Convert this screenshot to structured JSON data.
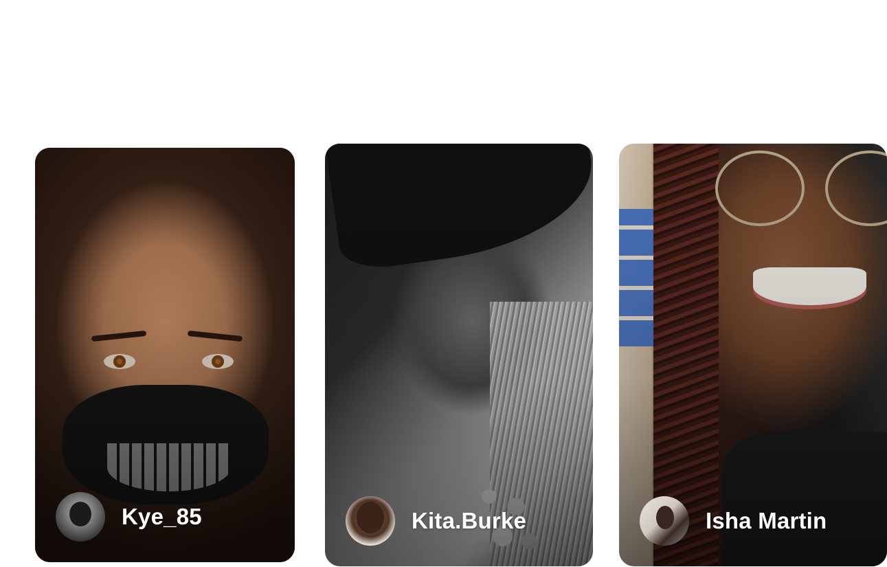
{
  "creators": [
    {
      "name": "Kye_85",
      "avatar_icon": "profile-photo-icon"
    },
    {
      "name": "Kita.Burke",
      "avatar_icon": "profile-photo-icon"
    },
    {
      "name": "Isha Martin",
      "avatar_icon": "profile-photo-icon"
    }
  ],
  "colors": {
    "background": "#ffffff",
    "name_text": "#ffffff"
  }
}
